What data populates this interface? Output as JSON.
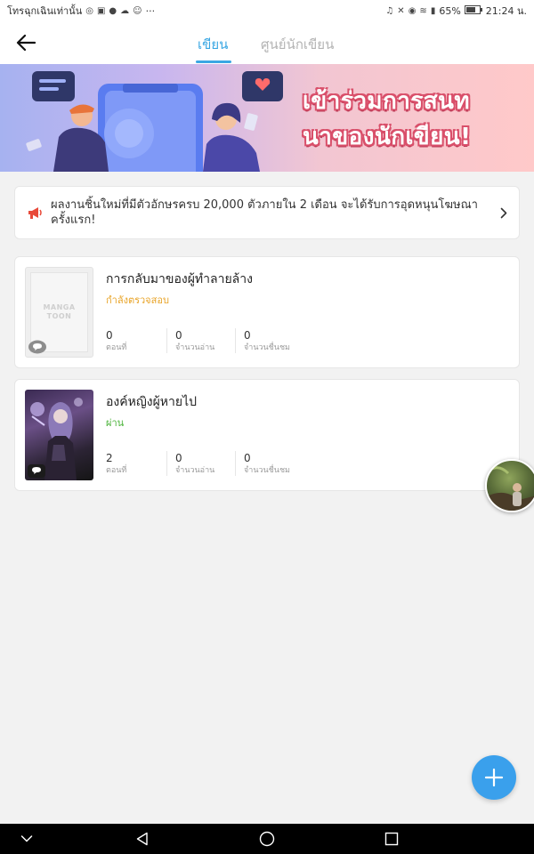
{
  "status_bar": {
    "left_text": "โทรฉุกเฉินเท่านั้น",
    "left_icons": [
      "messenger-icon",
      "media-icon",
      "line-icon",
      "cloud-icon",
      "emoji-icon"
    ],
    "more": "···",
    "battery": "65%",
    "time": "21:24 น."
  },
  "header": {
    "tabs": [
      {
        "label": "เขียน",
        "active": true
      },
      {
        "label": "ศูนย์นักเขียน",
        "active": false
      }
    ]
  },
  "banner": {
    "line1": "เข้าร่วมการสนท",
    "line2": "นาของนักเขียน!"
  },
  "notice": {
    "text": "ผลงานชิ้นใหม่ที่มีตัวอักษรครบ 20,000 ตัวภายใน 2 เดือน จะได้รับการอุดหนุนโฆษณาครั้งแรก!"
  },
  "works": [
    {
      "title": "การกลับมาของผู้ทำลายล้าง",
      "status": "กำลังตรวจสอบ",
      "cover_logo": [
        "MANGA",
        "TOON"
      ],
      "stats": [
        {
          "value": "0",
          "label": "ตอนที่"
        },
        {
          "value": "0",
          "label": "จำนวนอ่าน"
        },
        {
          "value": "0",
          "label": "จำนวนชื่นชม"
        }
      ]
    },
    {
      "title": "องค์หญิงผู้หายไป",
      "status": "ผ่าน",
      "stats": [
        {
          "value": "2",
          "label": "ตอนที่"
        },
        {
          "value": "0",
          "label": "จำนวนอ่าน"
        },
        {
          "value": "0",
          "label": "จำนวนชื่นชม"
        }
      ]
    }
  ],
  "colors": {
    "accent": "#3aa7e3",
    "status_review": "#e8a326",
    "status_pass": "#4bb33a",
    "fab": "#3aa0ec"
  }
}
